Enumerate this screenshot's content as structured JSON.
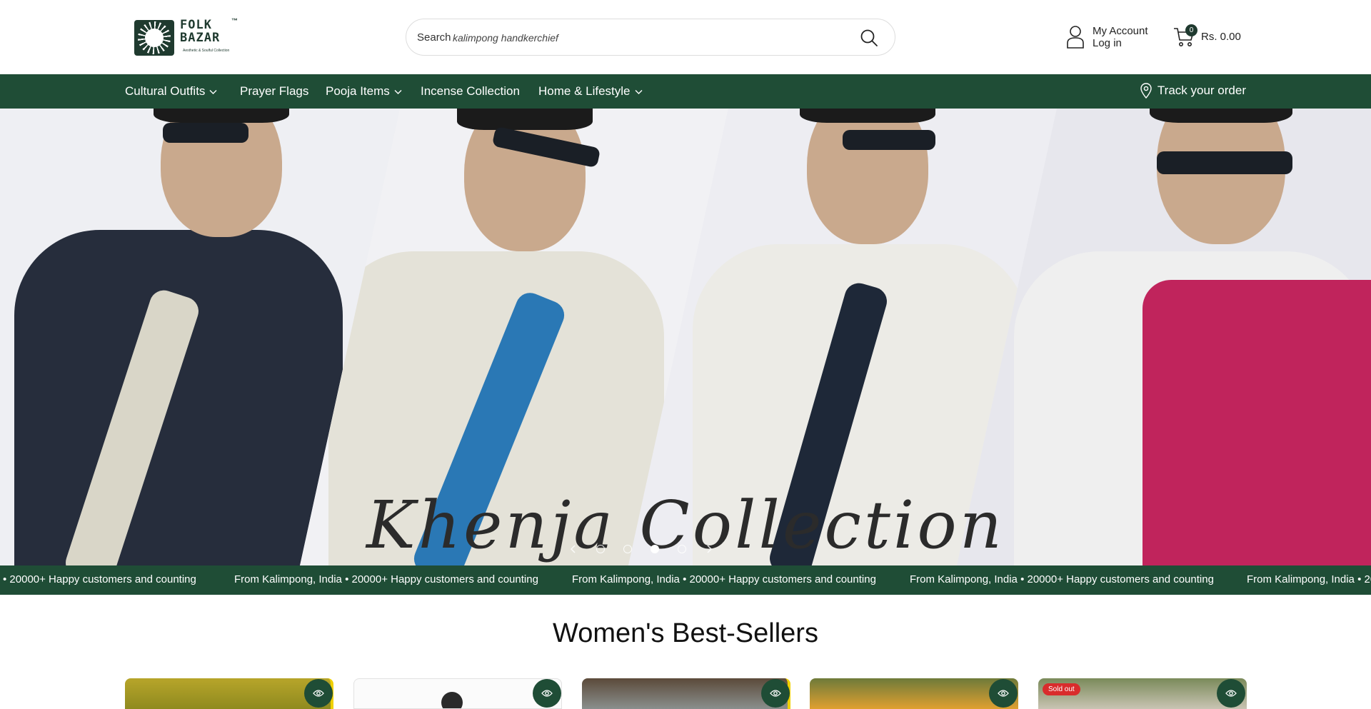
{
  "header": {
    "logo_line1": "FOLK",
    "logo_line2": "BAZAR",
    "logo_tm": "™",
    "logo_tagline": "Aesthetic & Soulful Collection",
    "search_label": "Search",
    "search_value": "kalimpong handkerchief",
    "account_line1": "My Account",
    "account_line2": "Log in",
    "cart_count": "0",
    "cart_total": "Rs. 0.00"
  },
  "nav": {
    "items": [
      {
        "label": "Cultural Outfits",
        "dropdown": true
      },
      {
        "label": "Prayer Flags",
        "dropdown": false
      },
      {
        "label": "Pooja Items",
        "dropdown": true
      },
      {
        "label": "Incense Collection",
        "dropdown": false
      },
      {
        "label": "Home & Lifestyle",
        "dropdown": true
      }
    ],
    "track_order": "Track your order"
  },
  "hero": {
    "caption": "Khenja Collection",
    "slides_count": 4,
    "active_slide": 3
  },
  "ticker": {
    "items": [
      "• 20000+ Happy customers and counting",
      "From Kalimpong, India • 20000+ Happy customers and counting",
      "From Kalimpong, India • 20000+ Happy customers and counting",
      "From Kalimpong, India • 20000+ Happy customers and counting",
      "From Kalimpong, India • 20"
    ]
  },
  "section": {
    "title": "Women's Best-Sellers",
    "sold_out_label": "Sold out"
  },
  "colors": {
    "brand_green": "#1f4d36",
    "sold_out_red": "#d92c2c"
  }
}
